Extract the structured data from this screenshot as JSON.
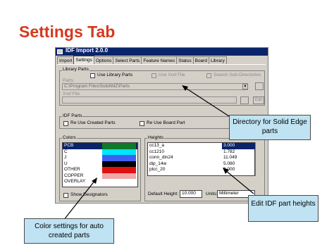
{
  "slide": {
    "title": "Settings Tab"
  },
  "window": {
    "title": "IDF Import 2.0.0",
    "tabs": [
      "Import",
      "Settings",
      "Options",
      "Select Parts",
      "Feature Names",
      "Status",
      "Board",
      "Library"
    ],
    "active_tab": "Settings"
  },
  "library_parts": {
    "group_label": "Library Parts",
    "use_library_parts": "Use Library Parts",
    "use_xref_file": "Use Xref File",
    "search_sub_directories": "Search Sub-Directories",
    "parts_label": "Parts",
    "parts_path": "C:\\Program Files\\Solid\\MZ\\Parts",
    "xref_label": "Xref File",
    "edit_button": "Edit"
  },
  "idf_parts": {
    "group_label": "IDF Parts",
    "reuse_created_parts": "Re Use Created Parts",
    "reuse_board_part": "Re Use Board Part"
  },
  "colors": {
    "group_label": "Colors",
    "items": [
      {
        "label": "PCB",
        "color": "#0f7a2a",
        "selected": true
      },
      {
        "label": "C",
        "color": "#00e5ff"
      },
      {
        "label": "J",
        "color": "#3d5ff2"
      },
      {
        "label": "U",
        "color": "#000000"
      },
      {
        "label": "OTHER",
        "color": "#e01010"
      },
      {
        "label": "COPPER",
        "color": "#f0a8a8"
      },
      {
        "label": "OVERLAY",
        "color": ""
      }
    ],
    "show_designators": "Show Designators"
  },
  "heights": {
    "group_label": "Heights",
    "rows": [
      {
        "name": "cc13_a",
        "value": "3.000",
        "selected": true
      },
      {
        "name": "cc1210",
        "value": "1.782"
      },
      {
        "name": "conn_din24",
        "value": "11.049"
      },
      {
        "name": "dip_14w",
        "value": "5.080"
      },
      {
        "name": "plcc_20",
        "value": "0.000"
      }
    ],
    "default_height_label": "Default Height:",
    "default_height_value": "10.000",
    "units_label": "Units:",
    "units_value": "Millimeter"
  },
  "callouts": {
    "directory": "Directory for Solid Edge parts",
    "heights": "Edit IDF part heights",
    "colors": "Color settings for auto created parts"
  }
}
